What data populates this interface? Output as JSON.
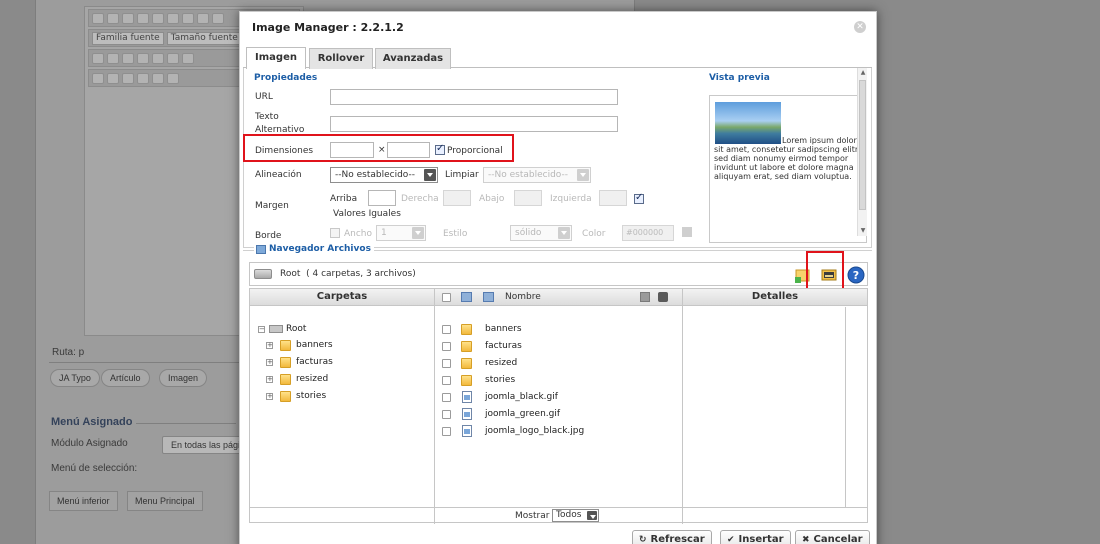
{
  "background": {
    "editor_toolbar": {
      "font_family_select": "Familia fuente",
      "font_size_select": "Tamaño fuente"
    },
    "path_label": "Ruta: p",
    "buttons": [
      "JA Typo",
      "Artículo",
      "Imagen"
    ],
    "menu_assigned_heading": "Menú Asignado",
    "module_assigned_label": "Módulo Asignado",
    "module_assigned_value": "En todas las págin",
    "menu_selection_label": "Menú de selección:",
    "menu_tabs": [
      "Menú inferior",
      "Menu Principal"
    ]
  },
  "modal": {
    "title": "Image Manager : 2.2.1.2",
    "close_icon": "close-icon",
    "tabs": [
      {
        "label": "Imagen",
        "active": true
      },
      {
        "label": "Rollover",
        "active": false
      },
      {
        "label": "Avanzadas",
        "active": false
      }
    ],
    "properties": {
      "heading": "Propiedades",
      "url_label": "URL",
      "url_value": "",
      "alt_label_line1": "Texto",
      "alt_label_line2": "Alternativo",
      "alt_value": "",
      "dimensions_label": "Dimensiones",
      "width_value": "",
      "times_sign": "×",
      "height_value": "",
      "proportional_label": "Proporcional",
      "proportional_checked": true,
      "align_label": "Alineación",
      "align_value": "--No establecido--",
      "clear_label": "Limpiar",
      "clear_value": "--No establecido--",
      "margin_label": "Margen",
      "margin_top_label": "Arriba",
      "margin_right_label": "Derecha",
      "margin_bottom_label": "Abajo",
      "margin_left_label": "Izquierda",
      "equal_values_label": "Valores Iguales",
      "equal_values_checked": true,
      "border_label": "Borde",
      "border_width_label": "Ancho",
      "border_width_value": "1",
      "border_style_label": "Estilo",
      "border_style_value": "sólido",
      "border_color_label": "Color",
      "border_color_value": "#000000"
    },
    "preview": {
      "heading": "Vista previa",
      "text": "Lorem ipsum dolor sit amet, consetetur sadipscing elitr, sed diam nonumy eirmod tempor invidunt ut labore et dolore magna aliquyam erat, sed diam voluptua."
    },
    "file_browser": {
      "legend": "Navegador Archivos",
      "root_label": "Root",
      "root_summary": "( 4 carpetas, 3 archivos)",
      "tool_icons": [
        "new-folder-icon",
        "upload-image-icon",
        "help-icon"
      ],
      "columns": {
        "folders": "Carpetas",
        "name": "Nombre",
        "details": "Detalles"
      },
      "tree": {
        "root": "Root",
        "folders": [
          "banners",
          "facturas",
          "resized",
          "stories"
        ]
      },
      "items": [
        {
          "name": "banners",
          "type": "folder"
        },
        {
          "name": "facturas",
          "type": "folder"
        },
        {
          "name": "resized",
          "type": "folder"
        },
        {
          "name": "stories",
          "type": "folder"
        },
        {
          "name": "joomla_black.gif",
          "type": "file"
        },
        {
          "name": "joomla_green.gif",
          "type": "file"
        },
        {
          "name": "joomla_logo_black.jpg",
          "type": "file"
        }
      ],
      "show_label": "Mostrar",
      "show_value": "Todos"
    },
    "actions": {
      "refresh": "Refrescar",
      "insert": "Insertar",
      "cancel": "Cancelar"
    },
    "colors": {
      "accent_blue": "#1d5ea6",
      "highlight_red": "#e0131b"
    }
  }
}
